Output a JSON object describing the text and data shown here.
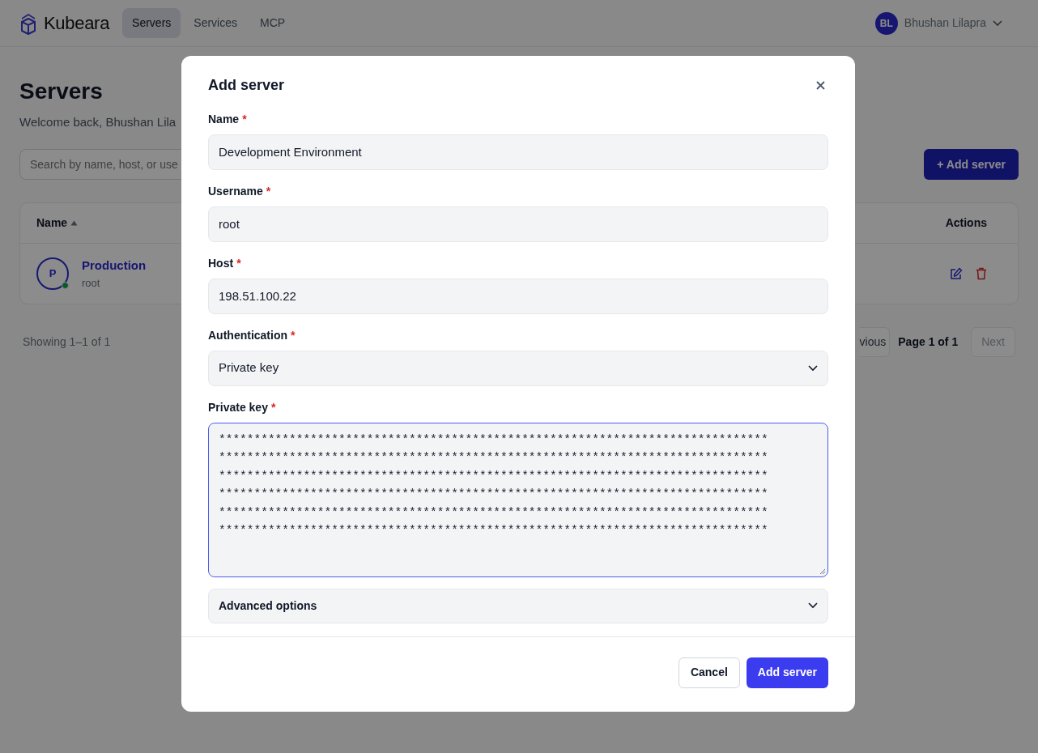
{
  "navbar": {
    "brand": "Kubeara",
    "tabs": [
      {
        "label": "Servers",
        "selected": true
      },
      {
        "label": "Services",
        "selected": false
      },
      {
        "label": "MCP",
        "selected": false
      }
    ],
    "user": {
      "initials": "BL",
      "name": "Bhushan Lilapra"
    }
  },
  "page": {
    "title": "Servers",
    "subtitle": "Welcome back, Bhushan Lila",
    "search": {
      "placeholder": "Search by name, host, or use"
    },
    "add_button": "+ Add server",
    "table": {
      "columns": [
        {
          "label": "Name",
          "sorted": true
        },
        {
          "label": "Actions",
          "sorted": false
        }
      ],
      "rows": [
        {
          "initial": "P",
          "name": "Production",
          "username": "root",
          "online": true
        }
      ]
    },
    "pagination": {
      "summary": "Showing 1–1 of 1",
      "previous": "vious",
      "page": "Page 1 of 1",
      "next": "Next",
      "next_disabled": true
    }
  },
  "modal": {
    "title": "Add server",
    "fields": [
      {
        "kind": "text",
        "label": "Name",
        "required_mark": "*",
        "value": "Development Environment",
        "focused": false
      },
      {
        "kind": "text",
        "label": "Username",
        "required_mark": "*",
        "value": "root",
        "focused": false
      },
      {
        "kind": "text",
        "label": "Host",
        "required_mark": "*",
        "value": "198.51.100.22",
        "focused": false
      },
      {
        "kind": "select",
        "label": "Authentication",
        "required_mark": "*",
        "value": "Private key",
        "focused": false
      },
      {
        "kind": "textarea",
        "label": "Private key",
        "required_mark": "*",
        "focused": true,
        "lines": [
          "******************************************************************************",
          "******************************************************************************",
          "******************************************************************************",
          "******************************************************************************",
          "******************************************************************************",
          "******************************************************************************"
        ]
      }
    ],
    "advanced": {
      "label": "Advanced options",
      "expanded": false
    },
    "buttons": [
      {
        "kind": "secondary",
        "label": "Cancel"
      },
      {
        "kind": "primary",
        "label": "Add server"
      }
    ]
  }
}
